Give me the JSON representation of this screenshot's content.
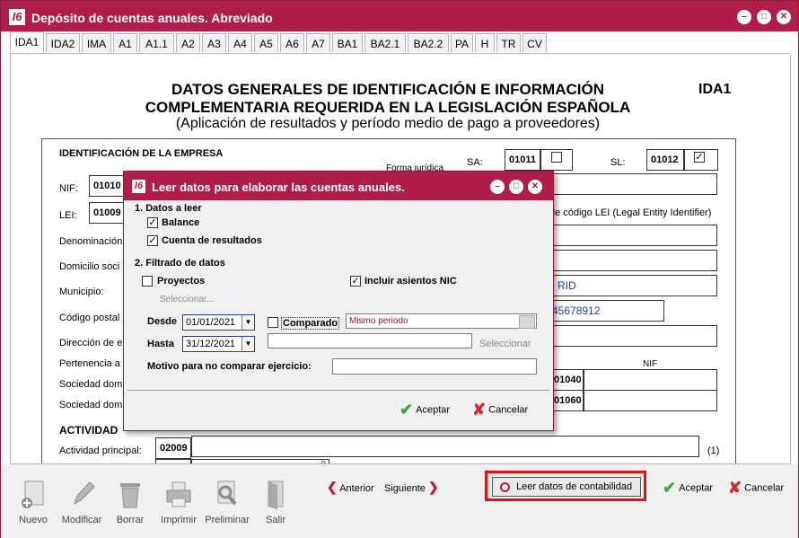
{
  "window": {
    "title": "Depósito de cuentas anuales. Abreviado",
    "logo_text": "I6"
  },
  "tabs": [
    "IDA1",
    "IDA2",
    "IMA",
    "A1",
    "A1.1",
    "A2",
    "A3",
    "A4",
    "A5",
    "A6",
    "A7",
    "BA1",
    "BA2.1",
    "BA2.2",
    "PA",
    "H",
    "TR",
    "CV"
  ],
  "form": {
    "title_line1": "DATOS GENERALES DE IDENTIFICACIÓN E INFORMACIÓN",
    "title_line2": "COMPLEMENTARIA REQUERIDA EN LA LEGISLACIÓN ESPAÑOLA",
    "subtitle": "(Aplicación de resultados y período medio de pago a proveedores)",
    "code": "IDA1",
    "section_empresa": "IDENTIFICACIÓN DE LA EMPRESA",
    "forma_juridica_partial": "Forma jurídica",
    "sa_label": "SA:",
    "sa_code": "01011",
    "sl_label": "SL:",
    "sl_code": "01012",
    "sl_checked": "✓",
    "nif_label": "NIF:",
    "nif_code": "01010",
    "lei_label": "LEI:",
    "lei_code": "01009",
    "lei_note": "de código LEI (Legal Entity Identifier)",
    "denominacion_label": "Denominación",
    "domicilio_label": "Domicilio soci",
    "municipio_label": "Municipio:",
    "municipio_value": "RID",
    "codigo_postal_label": "Código postal",
    "telefono_value": "45678912",
    "direccion_label": "Dirección de e",
    "pertenencia_label": "Pertenencia a",
    "nif_col_label": "NIF",
    "sociedad_dom1_label": "Sociedad dom",
    "sociedad_dom1_code": "01040",
    "sociedad_dom2_label": "Sociedad domi",
    "sociedad_dom2_code": "01060",
    "section_actividad": "ACTIVIDAD",
    "actividad_label": "Actividad principal:",
    "actividad_code": "02009",
    "actividad_note": "(1)",
    "row_partial_value": "0"
  },
  "dialog": {
    "title": "Leer datos para elaborar las cuentas anuales.",
    "section1": "1. Datos a leer",
    "balance_label": "Balance",
    "cuenta_label": "Cuenta de resultados",
    "section2": "2. Filtrado de datos",
    "proyectos_label": "Proyectos",
    "seleccionar1": "Seleccionar...",
    "incluir_label": "Incluir asientos NIC",
    "desde_label": "Desde",
    "desde_value": "01/01/2021",
    "hasta_label": "Hasta",
    "hasta_value": "31/12/2021",
    "comparado_label": "Comparado",
    "periodo_value": "Mismo periodo",
    "seleccionar2": "Seleccionar",
    "motivo_label": "Motivo para no comparar ejercicio:",
    "aceptar": "Aceptar",
    "cancelar": "Cancelar",
    "check_mark": "✓"
  },
  "toolbar": {
    "nuevo": "Nuevo",
    "modificar": "Modificar",
    "borrar": "Borrar",
    "imprimir": "Imprimir",
    "preliminar": "Preliminar",
    "salir": "Salir",
    "anterior": "Anterior",
    "siguiente": "Siguiente",
    "leer_datos": "Leer datos de contabilidad",
    "aceptar": "Aceptar",
    "cancelar": "Cancelar"
  },
  "colors": {
    "title_bar": "#b01d48",
    "highlight": "#e01010",
    "link_blue": "#1f3ea8"
  }
}
